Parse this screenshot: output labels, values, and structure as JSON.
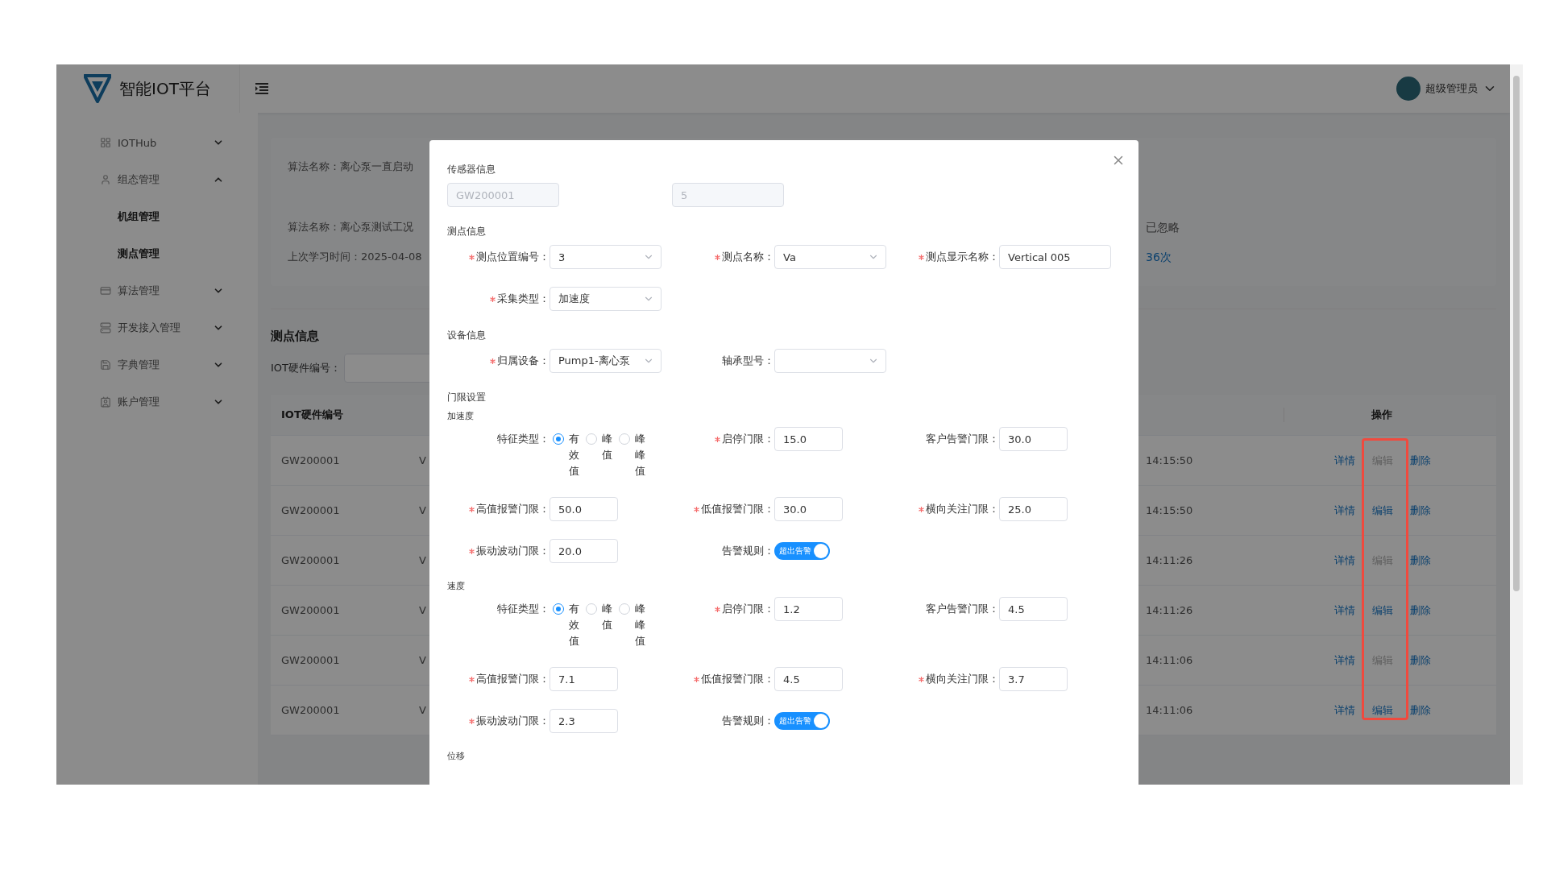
{
  "header": {
    "title": "智能IOT平台",
    "user": "超级管理员"
  },
  "sidebar": {
    "items": [
      {
        "label": "IOTHub",
        "expanded": false
      },
      {
        "label": "组态管理",
        "expanded": true,
        "children": [
          {
            "label": "机组管理"
          },
          {
            "label": "测点管理"
          }
        ]
      },
      {
        "label": "算法管理",
        "expanded": false
      },
      {
        "label": "开发接入管理",
        "expanded": false
      },
      {
        "label": "字典管理",
        "expanded": false
      },
      {
        "label": "账户管理",
        "expanded": false
      }
    ]
  },
  "summary_card": {
    "groups": [
      [
        {
          "text": "算法名称：离心泵一直启动"
        }
      ],
      [
        {
          "text": "算法名称：离心泵测试工况",
          "right": {
            "text": "已忽略",
            "kind": "plain"
          }
        },
        {
          "text": "上次学习时间：2025-04-08",
          "right": {
            "text": "36次",
            "kind": "link"
          }
        }
      ]
    ]
  },
  "list": {
    "title": "测点信息",
    "search_label": "IOT硬件编号：",
    "columns": [
      {
        "label": "IOT硬件编号"
      },
      {
        "label": "操作"
      }
    ],
    "rows": [
      {
        "hardware_id": "GW200001",
        "column_2": "V",
        "time": "14:15:50",
        "actions": [
          {
            "label": "详情",
            "disabled": false
          },
          {
            "label": "编辑",
            "disabled": true
          },
          {
            "label": "删除",
            "disabled": false
          }
        ]
      },
      {
        "hardware_id": "GW200001",
        "column_2": "V",
        "time": "14:15:50",
        "actions": [
          {
            "label": "详情",
            "disabled": false
          },
          {
            "label": "编辑",
            "disabled": false
          },
          {
            "label": "删除",
            "disabled": false
          }
        ]
      },
      {
        "hardware_id": "GW200001",
        "column_2": "V",
        "time": "14:11:26",
        "actions": [
          {
            "label": "详情",
            "disabled": false
          },
          {
            "label": "编辑",
            "disabled": true
          },
          {
            "label": "删除",
            "disabled": false
          }
        ]
      },
      {
        "hardware_id": "GW200001",
        "column_2": "V",
        "time": "14:11:26",
        "actions": [
          {
            "label": "详情",
            "disabled": false
          },
          {
            "label": "编辑",
            "disabled": false
          },
          {
            "label": "删除",
            "disabled": false
          }
        ]
      },
      {
        "hardware_id": "GW200001",
        "column_2": "V",
        "time": "14:11:06",
        "actions": [
          {
            "label": "详情",
            "disabled": false
          },
          {
            "label": "编辑",
            "disabled": true
          },
          {
            "label": "删除",
            "disabled": false
          }
        ]
      },
      {
        "hardware_id": "GW200001",
        "column_2": "V",
        "time": "14:11:06",
        "actions": [
          {
            "label": "详情",
            "disabled": false
          },
          {
            "label": "编辑",
            "disabled": false
          },
          {
            "label": "删除",
            "disabled": false
          }
        ]
      }
    ]
  },
  "dialog": {
    "sections": [
      {
        "title": "传感器信息",
        "rows": [
          [
            {
              "kind": "readonly",
              "value": "GW200001"
            },
            {
              "kind": "readonly",
              "value": "5"
            }
          ]
        ]
      },
      {
        "title": "测点信息",
        "rows": [
          [
            {
              "kind": "select",
              "label": "测点位置编号：",
              "required": true,
              "value": "3"
            },
            {
              "kind": "select",
              "label": "测点名称：",
              "required": true,
              "value": "Va"
            },
            {
              "kind": "input",
              "label": "测点显示名称：",
              "required": true,
              "value": "Vertical 005"
            }
          ],
          [
            {
              "kind": "select",
              "label": "采集类型：",
              "required": true,
              "value": "加速度"
            }
          ]
        ]
      },
      {
        "title": "设备信息",
        "rows": [
          [
            {
              "kind": "select",
              "label": "归属设备：",
              "required": true,
              "value": "Pump1-离心泵"
            },
            {
              "kind": "select",
              "label": "轴承型号：",
              "required": false
            }
          ]
        ]
      },
      {
        "title": "门限设置",
        "groups": [
          {
            "title": "加速度",
            "rows": [
              [
                {
                  "kind": "radio",
                  "label": "特征类型：",
                  "required": false,
                  "options": [
                    {
                      "label": "有效值",
                      "selected": true
                    },
                    {
                      "label": "峰值",
                      "selected": false
                    },
                    {
                      "label": "峰峰值",
                      "selected": false
                    }
                  ]
                },
                {
                  "kind": "number",
                  "label": "启停门限：",
                  "required": true,
                  "value": "15.0"
                },
                {
                  "kind": "number",
                  "label": "客户告警门限：",
                  "required": false,
                  "value": "30.0"
                }
              ],
              [
                {
                  "kind": "number",
                  "label": "高值报警门限：",
                  "required": true,
                  "value": "50.0"
                },
                {
                  "kind": "number",
                  "label": "低值报警门限：",
                  "required": true,
                  "value": "30.0"
                },
                {
                  "kind": "number",
                  "label": "横向关注门限：",
                  "required": true,
                  "value": "25.0"
                }
              ],
              [
                {
                  "kind": "number",
                  "label": "振动波动门限：",
                  "required": true,
                  "value": "20.0"
                },
                {
                  "kind": "switch",
                  "label": "告警规则：",
                  "required": false,
                  "on": true,
                  "text": "超出告警"
                }
              ]
            ]
          },
          {
            "title": "速度",
            "rows": [
              [
                {
                  "kind": "radio",
                  "label": "特征类型：",
                  "required": false,
                  "options": [
                    {
                      "label": "有效值",
                      "selected": true
                    },
                    {
                      "label": "峰值",
                      "selected": false
                    },
                    {
                      "label": "峰峰值",
                      "selected": false
                    }
                  ]
                },
                {
                  "kind": "number",
                  "label": "启停门限：",
                  "required": true,
                  "value": "1.2"
                },
                {
                  "kind": "number",
                  "label": "客户告警门限：",
                  "required": false,
                  "value": "4.5"
                }
              ],
              [
                {
                  "kind": "number",
                  "label": "高值报警门限：",
                  "required": true,
                  "value": "7.1"
                },
                {
                  "kind": "number",
                  "label": "低值报警门限：",
                  "required": true,
                  "value": "4.5"
                },
                {
                  "kind": "number",
                  "label": "横向关注门限：",
                  "required": true,
                  "value": "3.7"
                }
              ],
              [
                {
                  "kind": "number",
                  "label": "振动波动门限：",
                  "required": true,
                  "value": "2.3"
                },
                {
                  "kind": "switch",
                  "label": "告警规则：",
                  "required": false,
                  "on": true,
                  "text": "超出告警"
                }
              ]
            ]
          },
          {
            "title": "位移"
          }
        ]
      }
    ]
  }
}
